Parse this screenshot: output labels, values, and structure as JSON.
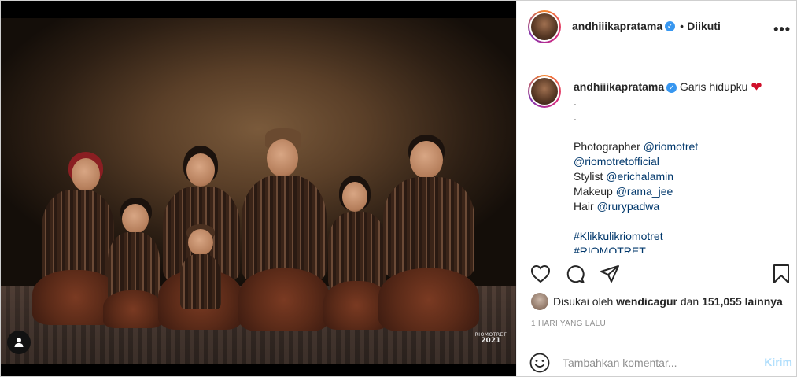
{
  "photo": {
    "watermark_brand": "RIOMOTRET",
    "watermark_year": "2021",
    "tag_icon": "user-tag-icon"
  },
  "header": {
    "username": "andhiiikapratama",
    "verified": "✓",
    "separator": "•",
    "follow_status": "Diikuti",
    "more_icon": "•••"
  },
  "caption": {
    "username": "andhiiikapratama",
    "verified": "✓",
    "first_text": "Garis hidupku",
    "heart": "❤",
    "dot1": ".",
    "dot2": ".",
    "photographer_label": "Photographer",
    "photographer_1": "@riomotret",
    "photographer_2": "@riomotretofficial",
    "stylist_label": "Stylist",
    "stylist": "@erichalamin",
    "makeup_label": "Makeup",
    "makeup": "@rama_jee",
    "hair_label": "Hair",
    "hair": "@rurypadwa",
    "hashtag_1": "#Klikkulikriomotret",
    "hashtag_2": "#RIOMOTRET"
  },
  "actions": {
    "like_icon": "heart-outline-icon",
    "comment_icon": "comment-icon",
    "share_icon": "share-icon",
    "save_icon": "bookmark-icon"
  },
  "likes": {
    "prefix": "Disukai oleh",
    "user": "wendicagur",
    "middle": "dan",
    "count": "151,055",
    "suffix": "lainnya"
  },
  "timestamp": "1 HARI YANG LALU",
  "comment": {
    "placeholder": "Tambahkan komentar...",
    "post_label": "Kirim"
  }
}
